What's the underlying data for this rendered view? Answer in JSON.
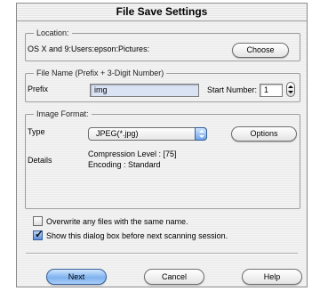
{
  "dialog": {
    "title": "File Save Settings"
  },
  "location": {
    "legend": "Location:",
    "path": "OS X and 9:Users:epson:Pictures:",
    "choose_label": "Choose"
  },
  "file_name": {
    "legend": "File Name (Prefix + 3-Digit Number)",
    "prefix_label": "Prefix",
    "prefix_value": "img",
    "start_number_label": "Start Number:",
    "start_number_value": "1"
  },
  "image_format": {
    "legend": "Image Format:",
    "type_label": "Type",
    "type_value": "JPEG(*.jpg)",
    "options_label": "Options",
    "details_label": "Details",
    "details_line1": "Compression Level : [75]",
    "details_line2": "Encoding : Standard"
  },
  "checkboxes": {
    "overwrite_label": "Overwrite any files with the same name.",
    "overwrite_checked": false,
    "show_dialog_label": "Show this dialog box before next scanning session.",
    "show_dialog_checked": true
  },
  "buttons": {
    "next_label": "Next",
    "cancel_label": "Cancel",
    "help_label": "Help"
  },
  "colors": {
    "default_button": "#7fb2ef",
    "prefix_field": "#d9e3f4"
  }
}
